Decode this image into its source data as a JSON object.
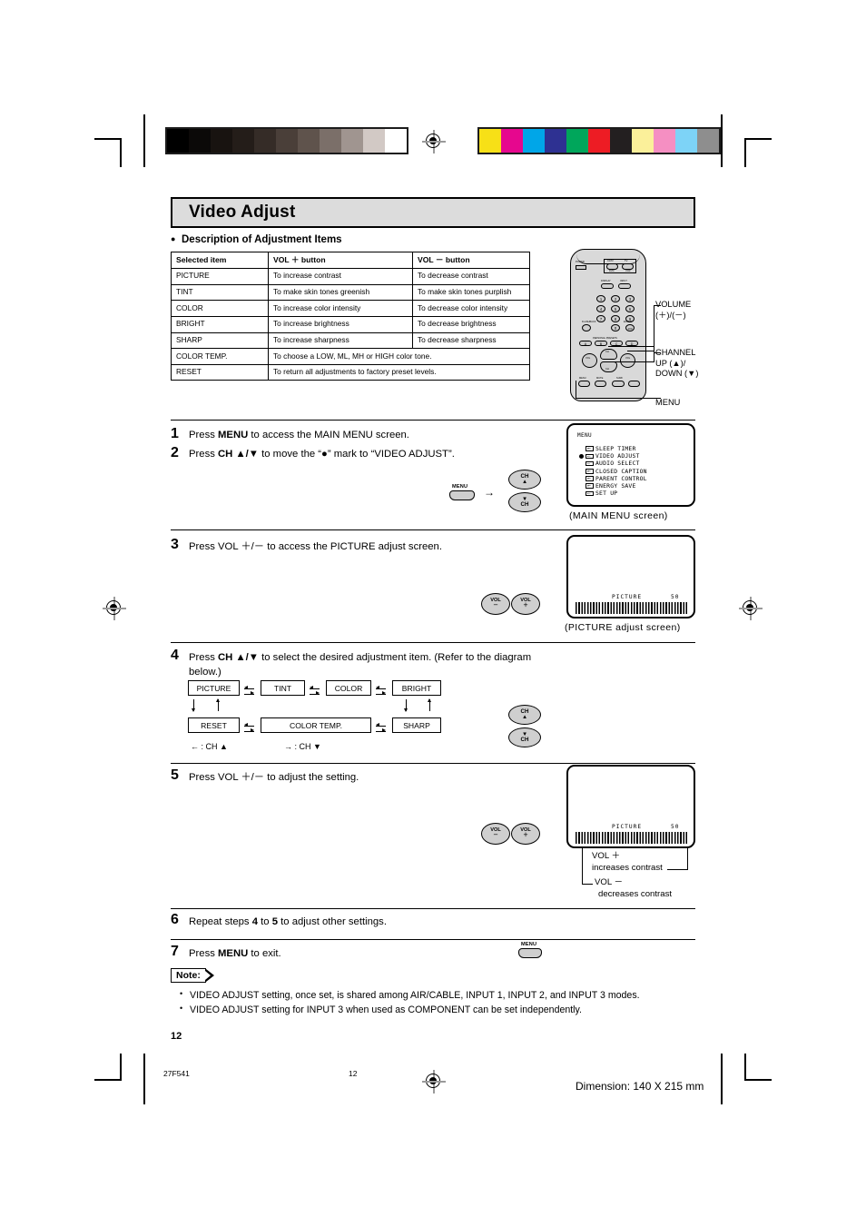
{
  "header": {
    "title": "Video Adjust"
  },
  "section": {
    "bullet": "●",
    "heading": "Description of Adjustment Items"
  },
  "table": {
    "columns": [
      "Selected item",
      "VOL ＋ button",
      "VOL － button"
    ],
    "rows": [
      {
        "item": "PICTURE",
        "plus": "To increase contrast",
        "minus": "To decrease contrast"
      },
      {
        "item": "TINT",
        "plus": "To make skin tones greenish",
        "minus": "To make skin tones purplish"
      },
      {
        "item": "COLOR",
        "plus": "To increase color intensity",
        "minus": "To decrease color intensity"
      },
      {
        "item": "BRIGHT",
        "plus": "To increase brightness",
        "minus": "To decrease brightness"
      },
      {
        "item": "SHARP",
        "plus": "To increase sharpness",
        "minus": "To decrease sharpness"
      },
      {
        "item": "COLOR TEMP.",
        "span": "To choose a LOW, ML, MH or HIGH color tone."
      },
      {
        "item": "RESET",
        "span": "To return all adjustments to factory preset levels."
      }
    ]
  },
  "remote": {
    "keys": {
      "power": "POWER",
      "catv": "CATV",
      "catv_sub": "DVD",
      "tv": "TV",
      "tv_sub": "VCR",
      "display": "DISPLAY",
      "input": "INPUT",
      "flashback": "FLASHBACK",
      "enter": "ENTER",
      "presets_title": "PERSONAL PRESETS",
      "preset_a": "A",
      "preset_b": "B",
      "preset_c": "C",
      "preset_d": "D",
      "vol_minus": "VOL",
      "vol_plus": "VOL",
      "ch_up": "CH",
      "ch_down": "CH",
      "menu": "MENU",
      "mute": "MUTE",
      "surf": "SURF"
    },
    "numbers": [
      "1",
      "2",
      "3",
      "4",
      "5",
      "6",
      "7",
      "8",
      "9",
      "0",
      "100"
    ],
    "callouts": {
      "volume": "VOLUME",
      "volume_sub": "(＋)/(－)",
      "channel": "CHANNEL",
      "channel_up": "UP (▲)/",
      "channel_down": "DOWN (▼)",
      "menu": "MENU"
    }
  },
  "steps": [
    {
      "num": "1",
      "text_parts": [
        "Press ",
        "MENU",
        " to access the MAIN MENU screen."
      ]
    },
    {
      "num": "2",
      "text_parts": [
        "Press ",
        "CH ▲/▼",
        " to move the “●” mark to “VIDEO ADJUST”."
      ]
    },
    {
      "num": "3",
      "text_parts": [
        "Press ",
        "VOL",
        " ＋/－ to access the PICTURE adjust screen."
      ]
    },
    {
      "num": "4",
      "text_parts": [
        "Press ",
        "CH ▲/▼",
        " to select the desired adjustment item. (Refer to the diagram below.)"
      ]
    },
    {
      "num": "5",
      "text_parts": [
        "Press ",
        "VOL",
        " ＋/－ to adjust the setting."
      ]
    },
    {
      "num": "6",
      "text_parts": [
        "Repeat steps ",
        "4",
        " to ",
        "5",
        " to adjust other settings."
      ]
    },
    {
      "num": "7",
      "text_parts": [
        "Press ",
        "MENU",
        " to exit."
      ]
    }
  ],
  "step1_text": "Press MENU to access the MAIN MENU screen.",
  "step2_text": "Press CH ▲/▼ to move the “●” mark to “VIDEO ADJUST”.",
  "step3_text": "Press VOL ＋/－ to access the PICTURE adjust screen.",
  "step4_text": "Press CH ▲/▼ to select the desired adjustment item. (Refer to the diagram below.)",
  "step5_text": "Press VOL ＋/－ to adjust the setting.",
  "step6_text": "Repeat steps 4 to 5 to adjust other settings.",
  "step7_text": "Press MENU to exit.",
  "osd": {
    "main_menu": {
      "title": "MENU",
      "items": [
        {
          "label": "SLEEP TIMER",
          "selected": false
        },
        {
          "label": "VIDEO ADJUST",
          "selected": true
        },
        {
          "label": "AUDIO SELECT",
          "selected": false
        },
        {
          "label": "CLOSED CAPTION",
          "selected": false
        },
        {
          "label": "PARENT CONTROL",
          "selected": false
        },
        {
          "label": "ENERGY SAVE",
          "selected": false
        },
        {
          "label": "SET UP",
          "selected": false
        }
      ],
      "caption": "(MAIN MENU screen)"
    },
    "picture_adjust": {
      "label": "PICTURE",
      "value": "50",
      "caption": "(PICTURE adjust screen)"
    },
    "picture_adjust2": {
      "label": "PICTURE",
      "value": "50"
    }
  },
  "step5_callouts": {
    "plus_line1": "VOL ＋",
    "plus_line2": "increases contrast",
    "minus_line1": "VOL －",
    "minus_line2": "decreases contrast"
  },
  "flow": {
    "boxes": [
      "PICTURE",
      "TINT",
      "COLOR",
      "BRIGHT",
      "RESET",
      "COLOR TEMP.",
      "SHARP"
    ],
    "legend_left": "← : CH ▲",
    "legend_right": "→ : CH ▼"
  },
  "buttons": {
    "menu": "MENU",
    "ch_up_top": "CH",
    "ch_up_arrow": "▲",
    "ch_down_arrow": "▼",
    "ch_down_bottom": "CH",
    "vol_minus": "VOL",
    "vol_minus_sign": "－",
    "vol_plus": "VOL",
    "vol_plus_sign": "＋",
    "arrow": "→"
  },
  "note": {
    "tag": "Note:",
    "items": [
      "VIDEO ADJUST setting, once set, is shared among AIR/CABLE, INPUT 1, INPUT 2, and INPUT 3 modes.",
      "VIDEO ADJUST setting for INPUT 3 when used as COMPONENT can be set independently."
    ]
  },
  "page_number": "12",
  "footer": {
    "model": "27F541",
    "page": "12",
    "dimension": "Dimension: 140  X 215 mm"
  },
  "calibration": {
    "grayscale": [
      "#000000",
      "#0b0908",
      "#181310",
      "#241d19",
      "#352c27",
      "#4a3f39",
      "#5f534c",
      "#7b6f69",
      "#a09590",
      "#d2c9c5",
      "#ffffff"
    ],
    "colors": [
      "#f7e017",
      "#e6078e",
      "#00a6e8",
      "#2e3192",
      "#00a65b",
      "#ed1c24",
      "#231f20",
      "#fbf09a",
      "#f58fc2",
      "#7dd3f7",
      "#8e8e8e"
    ]
  }
}
